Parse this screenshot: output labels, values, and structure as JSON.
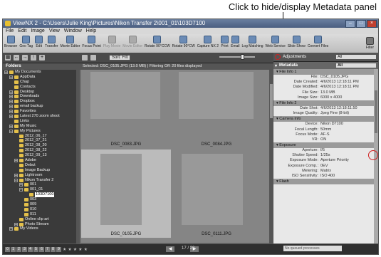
{
  "annotation": {
    "text": "Click to hide/display Metadata panel"
  },
  "window": {
    "title": "ViewNX 2 - C:\\Users\\Julie King\\Pictures\\Nikon Transfer 2\\001_01\\103D7100"
  },
  "menu": [
    "File",
    "Edit",
    "Image",
    "View",
    "Window",
    "Help"
  ],
  "toolbar": [
    {
      "label": "Browser",
      "disabled": false
    },
    {
      "label": "Geo Tag",
      "disabled": false
    },
    {
      "label": "Edit",
      "disabled": false
    },
    {
      "label": "Transfer",
      "disabled": false
    },
    {
      "label": "Movie Editor",
      "disabled": false
    },
    {
      "label": "Focus Point",
      "disabled": false
    },
    {
      "label": "Play Movie",
      "disabled": true
    },
    {
      "label": "Movie Editor",
      "disabled": true
    },
    {
      "label": "Rotate 90°CCW",
      "disabled": false
    },
    {
      "label": "Rotate 90°CW",
      "disabled": false
    },
    {
      "label": "Capture NX 2",
      "disabled": false
    },
    {
      "label": "Print",
      "disabled": false
    },
    {
      "label": "Email",
      "disabled": false
    },
    {
      "label": "Log Matching",
      "disabled": false
    },
    {
      "label": "Web Service",
      "disabled": false
    },
    {
      "label": "Slide Show",
      "disabled": false
    },
    {
      "label": "Convert Files",
      "disabled": false
    }
  ],
  "toolbar_right": [
    "",
    "Filter"
  ],
  "sort": {
    "label": "Sort: Filt"
  },
  "folders": {
    "header": "Folders",
    "items": [
      {
        "label": "My Documents",
        "exp": "+",
        "indent": 0
      },
      {
        "label": "AppData",
        "exp": "+",
        "indent": 1
      },
      {
        "label": "Chap",
        "exp": "",
        "indent": 1
      },
      {
        "label": "Contacts",
        "exp": "",
        "indent": 1
      },
      {
        "label": "Desktop",
        "exp": "+",
        "indent": 1
      },
      {
        "label": "Downloads",
        "exp": "+",
        "indent": 1
      },
      {
        "label": "Dropbox",
        "exp": "+",
        "indent": 1
      },
      {
        "label": "email backup",
        "exp": "+",
        "indent": 1
      },
      {
        "label": "Favorites",
        "exp": "+",
        "indent": 1
      },
      {
        "label": "Latest 270 zoom shoot",
        "exp": "+",
        "indent": 1
      },
      {
        "label": "Links",
        "exp": "",
        "indent": 1
      },
      {
        "label": "My Music",
        "exp": "+",
        "indent": 1
      },
      {
        "label": "My Pictures",
        "exp": "−",
        "indent": 1
      },
      {
        "label": "2012_06_17",
        "exp": "",
        "indent": 2
      },
      {
        "label": "2012_07_21",
        "exp": "",
        "indent": 2
      },
      {
        "label": "2012_08_20",
        "exp": "",
        "indent": 2
      },
      {
        "label": "2012_08_22",
        "exp": "",
        "indent": 2
      },
      {
        "label": "2012_09_13",
        "exp": "",
        "indent": 2
      },
      {
        "label": "Adobe",
        "exp": "+",
        "indent": 2
      },
      {
        "label": "Debut",
        "exp": "",
        "indent": 2
      },
      {
        "label": "Image Backup",
        "exp": "",
        "indent": 2
      },
      {
        "label": "Lightroom",
        "exp": "+",
        "indent": 2
      },
      {
        "label": "Nikon Transfer 2",
        "exp": "−",
        "indent": 2
      },
      {
        "label": "001",
        "exp": "+",
        "indent": 3
      },
      {
        "label": "001_01",
        "exp": "−",
        "indent": 3
      },
      {
        "label": "103D7100",
        "exp": "",
        "indent": 4,
        "selected": true
      },
      {
        "label": "003",
        "exp": "",
        "indent": 3
      },
      {
        "label": "009",
        "exp": "",
        "indent": 3
      },
      {
        "label": "010",
        "exp": "",
        "indent": 3
      },
      {
        "label": "011",
        "exp": "",
        "indent": 3
      },
      {
        "label": "Online clip art",
        "exp": "",
        "indent": 2
      },
      {
        "label": "Photo Stream",
        "exp": "+",
        "indent": 2
      },
      {
        "label": "My Videos",
        "exp": "+",
        "indent": 1
      }
    ]
  },
  "status": "Selected: DSC_0105.JPG (13.0 MB) | Filtering Off: 20 files displayed",
  "thumbnails": [
    {
      "caption": "DSC_0083.JPG"
    },
    {
      "caption": "DSC_0084.JPG"
    },
    {
      "caption": "DSC_0105.JPG"
    },
    {
      "caption": "DSC_0111.JPG"
    }
  ],
  "panel": {
    "adjustments_label": "Adjustments",
    "adjustments_select": "All",
    "metadata_label": "Metadata",
    "metadata_select": "All",
    "sections": [
      {
        "title": "File Info 1",
        "rows": [
          {
            "k": "File:",
            "v": "DSC_0105.JPG"
          },
          {
            "k": "Date Created:",
            "v": "4/6/2013 12:18:11 PM"
          },
          {
            "k": "Date Modified:",
            "v": "4/6/2013 12:18:11 PM"
          },
          {
            "k": "File Size:",
            "v": "13.0 MB"
          },
          {
            "k": "Image Size:",
            "v": "6000 x 4000"
          }
        ]
      },
      {
        "title": "File Info 2",
        "rows": [
          {
            "k": "Date Shot:",
            "v": "4/6/2013 12:18:11.50"
          },
          {
            "k": "Image Quality:",
            "v": "Jpeg Fine (8-bit)"
          }
        ]
      },
      {
        "title": "Camera Info",
        "rows": [
          {
            "k": "Device:",
            "v": "Nikon D7100"
          },
          {
            "k": "Focal Length:",
            "v": "50mm"
          },
          {
            "k": "Focus Mode:",
            "v": "AF-S"
          },
          {
            "k": "VR:",
            "v": "ON"
          }
        ]
      },
      {
        "title": "Exposure",
        "rows": [
          {
            "k": "Aperture:",
            "v": "f/5"
          },
          {
            "k": "Shutter Speed:",
            "v": "1/25s"
          },
          {
            "k": "Exposure Mode:",
            "v": "Aperture Priority"
          },
          {
            "k": "Exposure Comp.:",
            "v": "0EV"
          },
          {
            "k": "Metering:",
            "v": "Matrix"
          },
          {
            "k": "ISO Sensitivity:",
            "v": "ISO 400"
          }
        ]
      },
      {
        "title": "Flash",
        "rows": []
      }
    ]
  },
  "bottom": {
    "page": "17 / 20",
    "processing": "No queued processes",
    "label_squares": [
      "0",
      "1",
      "2",
      "3",
      "4",
      "5",
      "6",
      "7",
      "8",
      "9"
    ]
  },
  "colors": {
    "callout_circle": "#d02020"
  }
}
